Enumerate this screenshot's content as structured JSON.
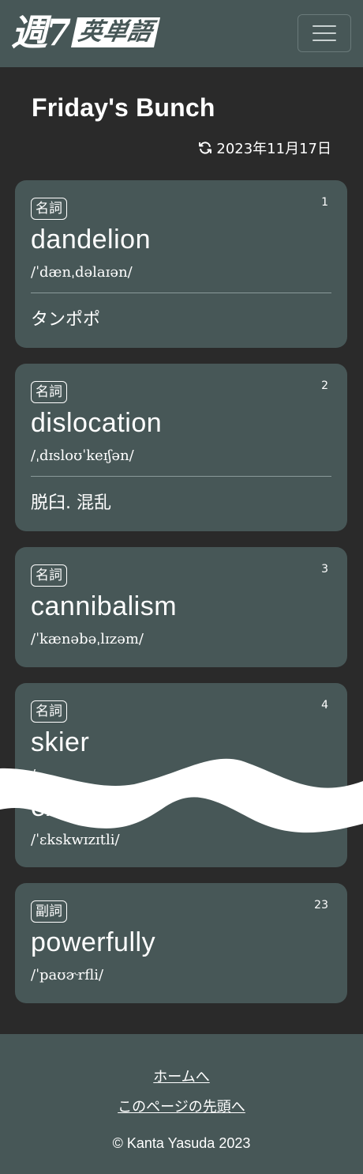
{
  "brand": {
    "text_a": "週7",
    "text_b": "英単語"
  },
  "page": {
    "title": "Friday's Bunch",
    "date": "2023年11月17日"
  },
  "cards": [
    {
      "pos": "名詞",
      "num": "1",
      "word": "dandelion",
      "pron": "/ˈdænˌdəlaɪən/",
      "meaning": "タンポポ"
    },
    {
      "pos": "名詞",
      "num": "2",
      "word": "dislocation",
      "pron": "/ˌdɪsloʊˈkeɪʃən/",
      "meaning": "脱臼. 混乱"
    },
    {
      "pos": "名詞",
      "num": "3",
      "word": "cannibalism",
      "pron": "/ˈkænəbəˌlɪzəm/"
    },
    {
      "pos": "名詞",
      "num": "4",
      "word": "skier",
      "pron": "/"
    },
    {
      "word": "exqu",
      "pron": "/ˈɛkskwɪzɪtli/"
    },
    {
      "pos": "副詞",
      "num": "23",
      "word": "powerfully",
      "pron": "/ˈpaʊɚrfli/"
    }
  ],
  "footer": {
    "home_link": "ホームへ",
    "top_link": "このページの先頭へ",
    "copyright": "© Kanta Yasuda 2023"
  },
  "icons": {
    "menu": "hamburger-menu-icon",
    "refresh": "refresh-icon"
  }
}
